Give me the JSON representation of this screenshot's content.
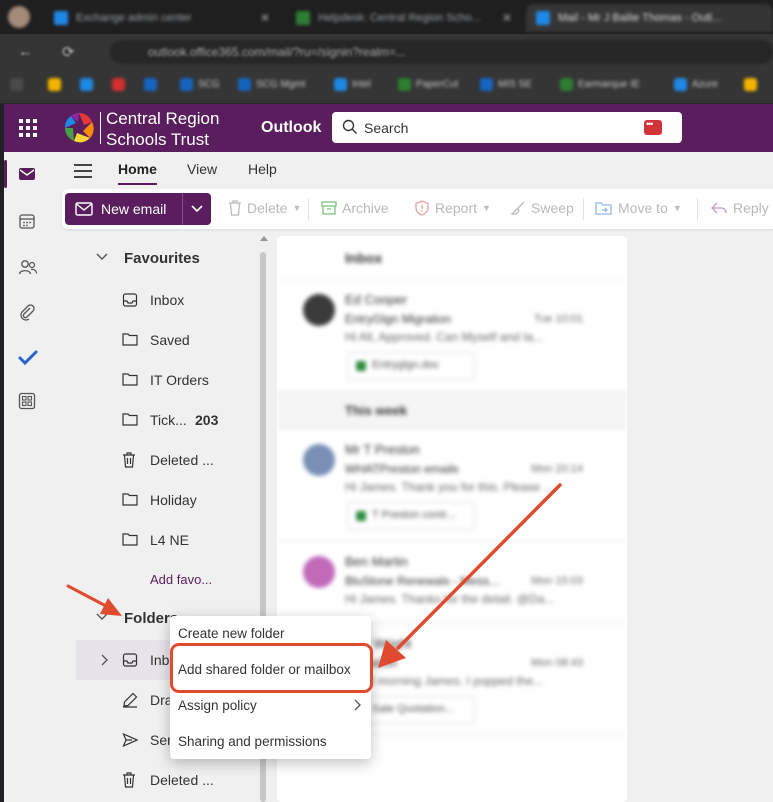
{
  "browser": {
    "tabs": [
      {
        "label": "Exchange admin center",
        "color": "#1e88e5"
      },
      {
        "label": "Helpdesk: Central Region Scho...",
        "color": "#2e7d32"
      },
      {
        "label": "Mail - Mr J Bailie Thomas - Outl...",
        "color": "#1e88e5"
      }
    ],
    "url": "outlook.office365.com/mail/?ru=/signin?realm=...",
    "bookmarks": [
      {
        "label": "",
        "color": "#f4b400"
      },
      {
        "label": "",
        "color": "#1e88e5"
      },
      {
        "label": "",
        "color": "#d32f2f"
      },
      {
        "label": "",
        "color": "#1565c0"
      },
      {
        "label": "SCG",
        "color": "#1565c0"
      },
      {
        "label": "SCG Mgmt",
        "color": "#1565c0"
      },
      {
        "label": "Intel",
        "color": "#1e88e5"
      },
      {
        "label": "PaperCut",
        "color": "#2e7d32"
      },
      {
        "label": "MIS SE",
        "color": "#1565c0"
      },
      {
        "label": "Earmarque IE",
        "color": "#2e7d32"
      },
      {
        "label": "Azure",
        "color": "#1e88e5"
      },
      {
        "label": "",
        "color": "#f4b400"
      }
    ]
  },
  "header": {
    "org_line1": "Central Region",
    "org_line2": "Schools Trust",
    "app_name": "Outlook",
    "search_placeholder": "Search"
  },
  "ribbon": {
    "tabs": [
      "Home",
      "View",
      "Help"
    ],
    "new_email": "New email",
    "actions": [
      "Delete",
      "Archive",
      "Report",
      "Sweep",
      "Move to",
      "Reply"
    ]
  },
  "folders": {
    "favourites_label": "Favourites",
    "favourites": [
      {
        "label": "Inbox",
        "icon": "inbox-icon"
      },
      {
        "label": "Saved",
        "icon": "folder-icon"
      },
      {
        "label": "IT Orders",
        "icon": "folder-icon"
      },
      {
        "label": "Tick...",
        "icon": "folder-icon",
        "count": "203"
      },
      {
        "label": "Deleted ...",
        "icon": "trash-icon"
      },
      {
        "label": "Holiday",
        "icon": "folder-icon"
      },
      {
        "label": "L4 NE",
        "icon": "folder-icon"
      }
    ],
    "add_favourite": "Add favo...",
    "folders_label": "Folders",
    "folders": [
      {
        "label": "Inbox",
        "icon": "inbox-icon"
      },
      {
        "label": "Drafts",
        "icon": "drafts-icon"
      },
      {
        "label": "Sent",
        "icon": "send-icon"
      },
      {
        "label": "Deleted ...",
        "icon": "trash-icon"
      }
    ]
  },
  "message_list": {
    "title": "Inbox",
    "messages_top": [
      {
        "from": "Ed Cooper",
        "subject": "EntryGlgn Migration",
        "preview": "Hi All, Approved. Can Myself and Ia...",
        "date": "Tue 10:01",
        "attachment": "Entryglgn.doc",
        "avatar": "#3b3b3b"
      }
    ],
    "week_label": "This week",
    "messages_week": [
      {
        "from": "Mr T Preston",
        "subject": "WHATPreston emails",
        "preview": "Hi James. Thank you for this. Please ...",
        "date": "Mon 20:14",
        "attachment": "T Preston contr...",
        "avatar": "#7a8fb5"
      },
      {
        "from": "Ben Martin",
        "subject": "BluStone Renewals - Mess...",
        "preview": "Hi James. Thanks for the detail. @Da...",
        "date": "Mon 15:03",
        "attachment": "",
        "avatar": "#c26ab8"
      },
      {
        "from": "Nick Wright",
        "subject": "Quotation",
        "preview": "Good morning James. I popped the...",
        "date": "Mon 08:43",
        "attachment": "Sale Quotation...",
        "avatar": "#ffffff"
      }
    ]
  },
  "context_menu": {
    "items": [
      "Create new folder",
      "Add shared folder or mailbox",
      "Assign policy",
      "Sharing and permissions"
    ],
    "highlighted_index": 1
  },
  "colors": {
    "brand": "#5a1e5e",
    "annotation": "#e04a2e"
  }
}
